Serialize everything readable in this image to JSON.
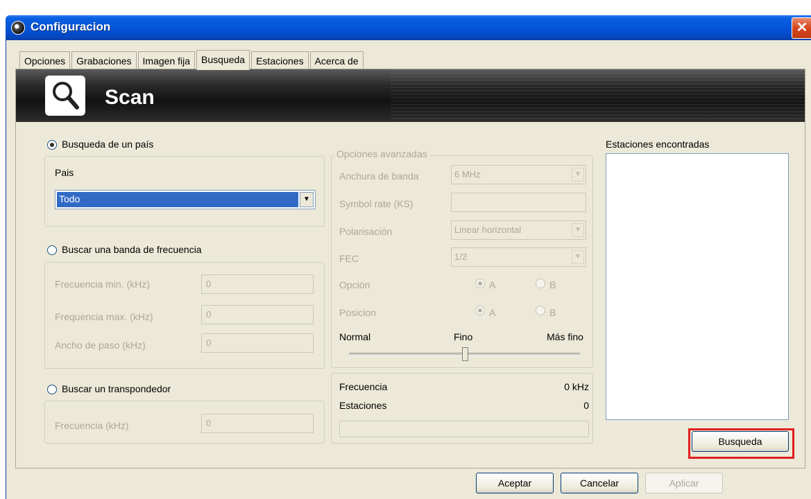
{
  "window": {
    "title": "Configuracion",
    "close_glyph": "✕"
  },
  "tabs": [
    "Opciones",
    "Grabaciones",
    "Imagen fija",
    "Busqueda",
    "Estaciones",
    "Acerca de"
  ],
  "active_tab": "Busqueda",
  "banner": {
    "title": "Scan",
    "icon": "magnifier-icon"
  },
  "country_search": {
    "radio_label": "Busqueda de un país",
    "checked": true,
    "country_label": "Pais",
    "country_value": "Todo"
  },
  "band_search": {
    "radio_label": "Buscar una banda de frecuencia",
    "checked": false,
    "fields": [
      {
        "label": "Frecuencia min. (kHz)",
        "value": "0"
      },
      {
        "label": "Frequencia max. (kHz)",
        "value": "0"
      },
      {
        "label": "Ancho de paso (kHz)",
        "value": "0"
      }
    ]
  },
  "transponder_search": {
    "radio_label": "Buscar un transpondedor",
    "checked": false,
    "field_label": "Frecuencia (kHz)",
    "field_value": "0"
  },
  "advanced": {
    "legend": "Opciones avanzadas",
    "bandwidth_label": "Anchura de banda",
    "bandwidth_value": "6 MHz",
    "symbol_rate_label": "Symbol rate (KS)",
    "symbol_rate_value": "",
    "polarisation_label": "Polarisación",
    "polarisation_value": "Linear horizontal",
    "fec_label": "FEC",
    "fec_value": "1/2",
    "option_label": "Opción",
    "position_label": "Posicion",
    "choice_a": "A",
    "choice_b": "B",
    "slider_labels": [
      "Normal",
      "Fino",
      "Más fino"
    ],
    "slider_level": 0.5
  },
  "status": {
    "frequency_label": "Frecuencia",
    "frequency_value": "0 kHz",
    "stations_label": "Estaciones",
    "stations_value": "0",
    "progress": 0
  },
  "found": {
    "label": "Estaciones encontradas",
    "items": []
  },
  "buttons": {
    "search": "Busqueda",
    "accept": "Aceptar",
    "cancel": "Cancelar",
    "apply": "Aplicar"
  },
  "colors": {
    "title_bar": "#0554d8",
    "highlight": "#e02020",
    "selection": "#316ac5"
  }
}
